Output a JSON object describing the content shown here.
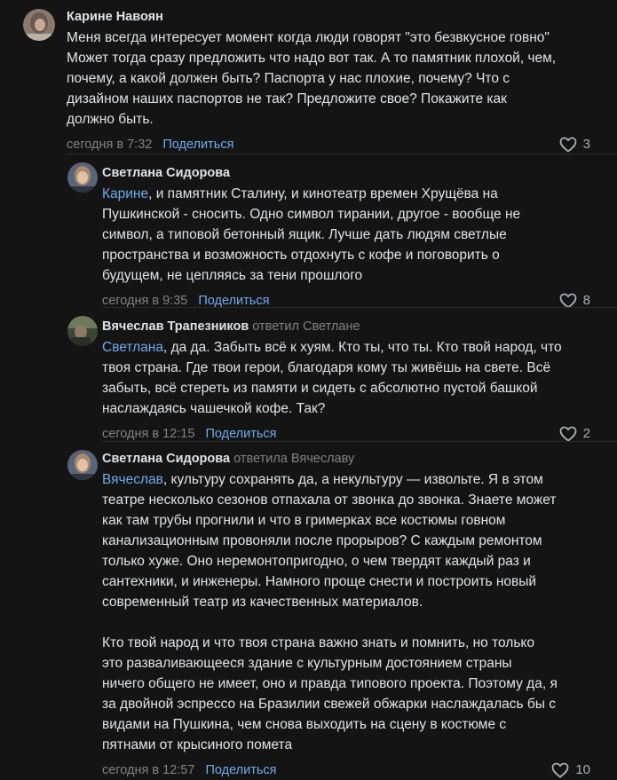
{
  "comments": [
    {
      "author": "Карине Навоян",
      "reply_to": "",
      "mention": "",
      "text": "Меня всегда интересует момент когда люди говорят \"это безвкусное говно\"\nМожет тогда сразу предложить что надо вот так. А то памятник плохой, чем,\nпочему, а какой должен быть? Паспорта у нас плохие, почему? Что с\nдизайном наших паспортов не так? Предложите свое? Покажите как\nдолжно быть.",
      "time": "сегодня в 7:32",
      "share_label": "Поделиться",
      "likes": "3",
      "avatar_icon": "avatar-karine-photo-icon"
    },
    {
      "author": "Светлана Сидорова",
      "reply_to": "",
      "mention": "Карине",
      "text": ", и памятник Сталину, и кинотеатр времен Хрущёва на\nПушкинской - сносить. Одно символ тирании, другое - вообще не\nсимвол, а типовой бетонный ящик. Лучше дать людям светлые\nпространства и возможность отдохнуть с кофе и поговорить о\nбудущем, не цепляясь за тени прошлого",
      "time": "сегодня в 9:35",
      "share_label": "Поделиться",
      "likes": "8",
      "avatar_icon": "avatar-svetlana-photo-icon"
    },
    {
      "author": "Вячеслав Трапезников",
      "reply_to": "ответил Светлане",
      "mention": "Светлана",
      "text": ", да да. Забыть всё к хуям. Кто ты, что ты. Кто твой народ, что\nтвоя страна. Где твои герои, благодаря кому ты живёшь на свете. Всё\nзабыть, всё стереть из памяти и сидеть с абсолютно пустой башкой\nнаслаждаясь чашечкой кофе. Так?",
      "time": "сегодня в 12:15",
      "share_label": "Поделиться",
      "likes": "2",
      "avatar_icon": "avatar-vyacheslav-photo-icon"
    },
    {
      "author": "Светлана Сидорова",
      "reply_to": "ответила Вячеславу",
      "mention": "Вячеслав",
      "text": ", культуру сохранять да, а некультуру — извольте. Я в этом\nтеатре несколько сезонов отпахала от звонка до звонка. Знаете может\nкак там трубы прогнили и что в гримерках все костюмы говном\nканализационным провоняли после прорыров? С каждым ремонтом\nтолько хуже. Оно неремонтопригодно, о чем твердят каждый раз и\nсантехники, и инженеры. Намного проще снести и построить новый\nсовременный театр из качественных материалов.\n\nКто твой народ и что твоя страна важно знать и помнить, но только\nэто разваливающееся здание с культурным достоянием страны\nничего общего не имеет, оно и правда типового проекта. Поэтому да, я\nза двойной эспрессо на Бразилии свежей обжарки наслаждалась бы с\nвидами на Пушкина, чем снова выходить на сцену в костюме с\nпятнами от крысиного помета",
      "time": "сегодня в 12:57",
      "share_label": "Поделиться",
      "likes": "10",
      "avatar_icon": "avatar-svetlana-photo-icon"
    }
  ],
  "colors": {
    "background": "#141414",
    "text": "#e1e3e6",
    "link": "#71aaeb",
    "muted": "#828282"
  },
  "icons": {
    "like": "heart-outline-icon"
  }
}
